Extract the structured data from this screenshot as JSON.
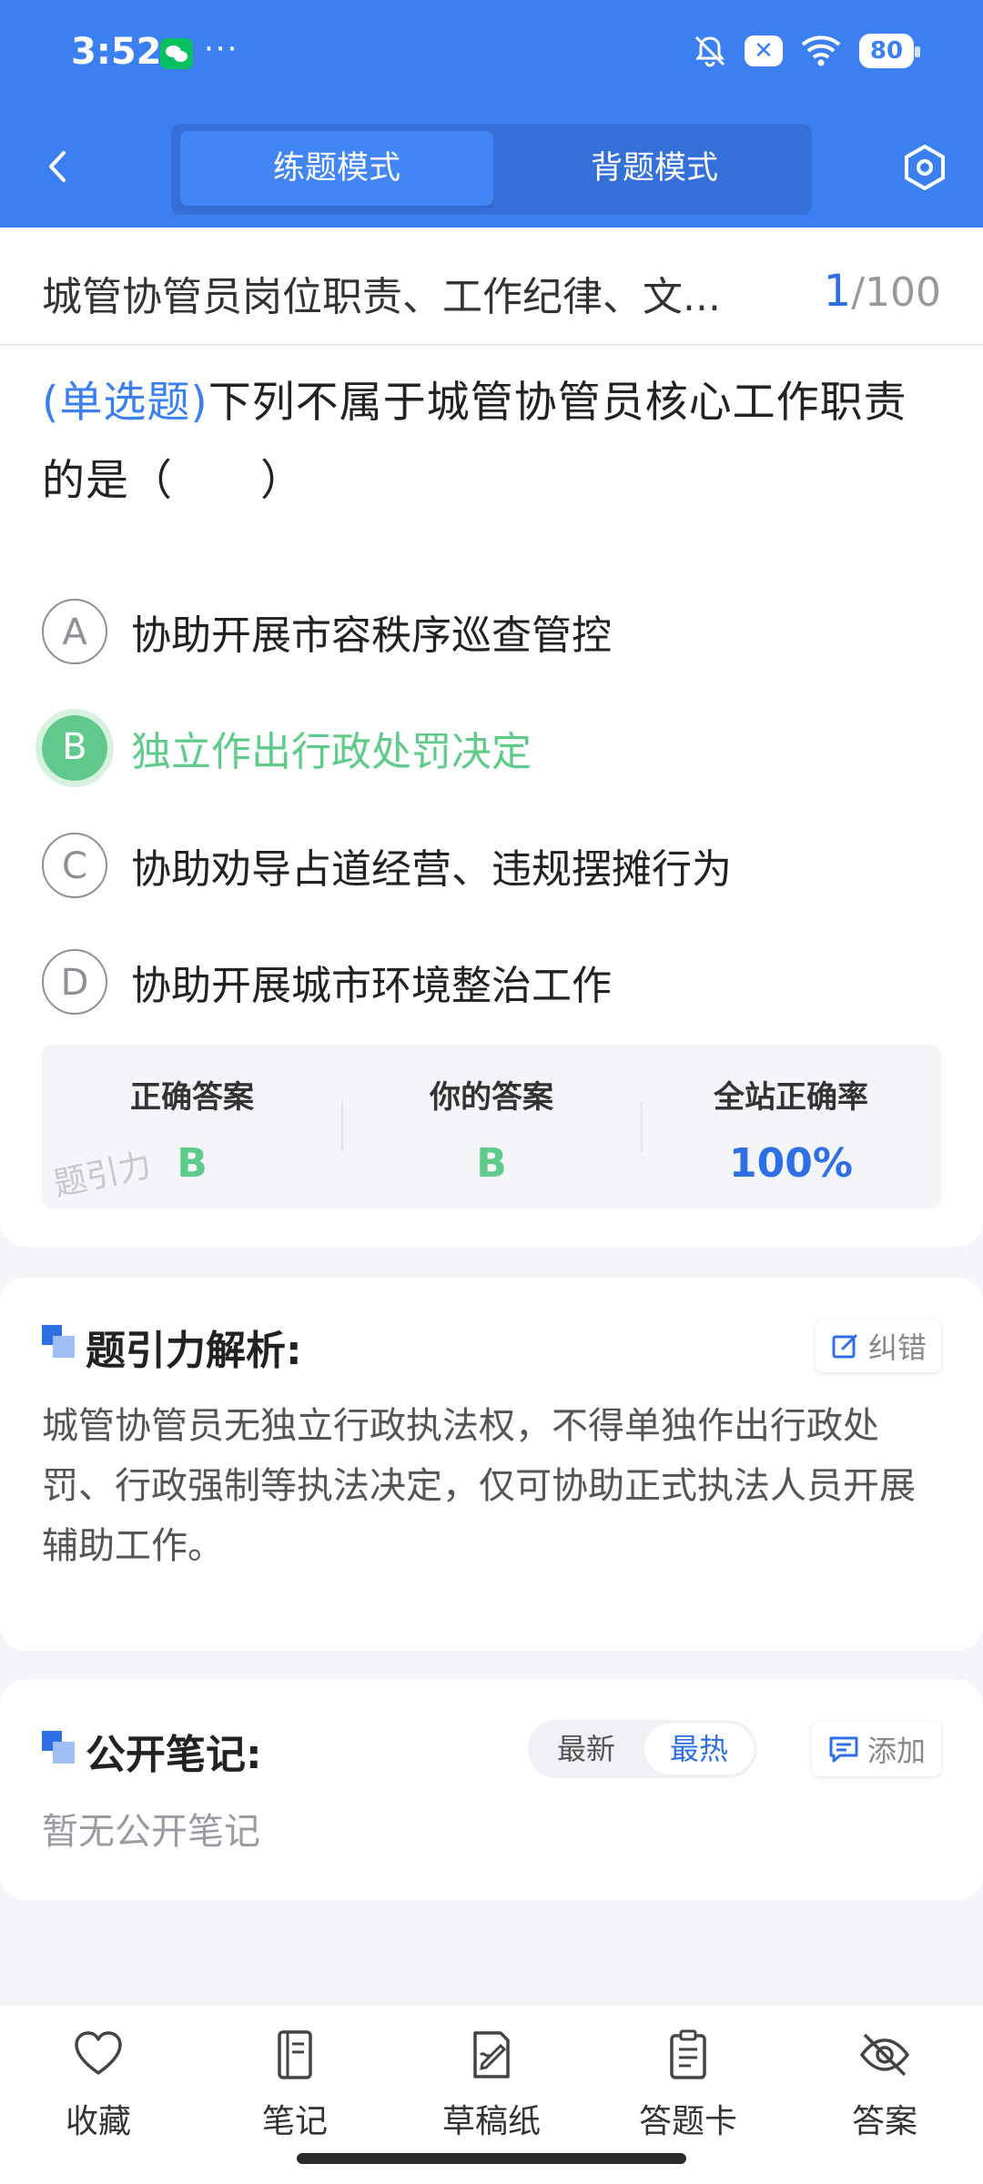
{
  "status_bar": {
    "time": "3:52",
    "dots": "···",
    "battery": "80",
    "icons": [
      "wechat-icon",
      "bell-off-icon",
      "xbox-icon",
      "wifi-icon",
      "battery-icon"
    ]
  },
  "header": {
    "tabs": [
      {
        "label": "练题模式",
        "active": true
      },
      {
        "label": "背题模式",
        "active": false
      }
    ],
    "back_icon": "chevron-left-icon",
    "settings_icon": "hexagon-settings-icon",
    "colors": {
      "primary": "#3b7ff0",
      "switch_bg": "#3570d9"
    }
  },
  "question": {
    "chapter_title": "城管协管员岗位职责、工作纪律、文...",
    "current": "1",
    "total": "/100",
    "type_label": "(单选题)",
    "text": "下列不属于城管协管员核心工作职责的是（　　）",
    "options": [
      {
        "letter": "A",
        "text": "协助开展市容秩序巡查管控",
        "state": "normal"
      },
      {
        "letter": "B",
        "text": "独立作出行政处罚决定",
        "state": "correct"
      },
      {
        "letter": "C",
        "text": "协助劝导占道经营、违规摆摊行为",
        "state": "normal"
      },
      {
        "letter": "D",
        "text": "协助开展城市环境整治工作",
        "state": "normal"
      }
    ]
  },
  "answer_summary": {
    "correct_label": "正确答案",
    "correct_value": "B",
    "yours_label": "你的答案",
    "yours_value": "B",
    "rate_label": "全站正确率",
    "rate_value": "100%",
    "watermark": "题引力",
    "colors": {
      "correct": "#5fcb8a",
      "rate": "#2f6fe4"
    }
  },
  "analysis": {
    "title": "题引力解析:",
    "report_label": "纠错",
    "text": "城管协管员无独立行政执法权，不得单独作出行政处罚、行政强制等执法决定，仅可协助正式执法人员开展辅助工作。"
  },
  "notes": {
    "title": "公开笔记:",
    "sort_options": [
      "最新",
      "最热"
    ],
    "active_sort": "最热",
    "add_label": "添加",
    "empty_text": "暂无公开笔记"
  },
  "bottom_nav": [
    {
      "label": "收藏",
      "icon": "heart-icon"
    },
    {
      "label": "笔记",
      "icon": "notebook-icon"
    },
    {
      "label": "草稿纸",
      "icon": "draft-icon"
    },
    {
      "label": "答题卡",
      "icon": "clipboard-icon"
    },
    {
      "label": "答案",
      "icon": "eye-off-icon"
    }
  ]
}
